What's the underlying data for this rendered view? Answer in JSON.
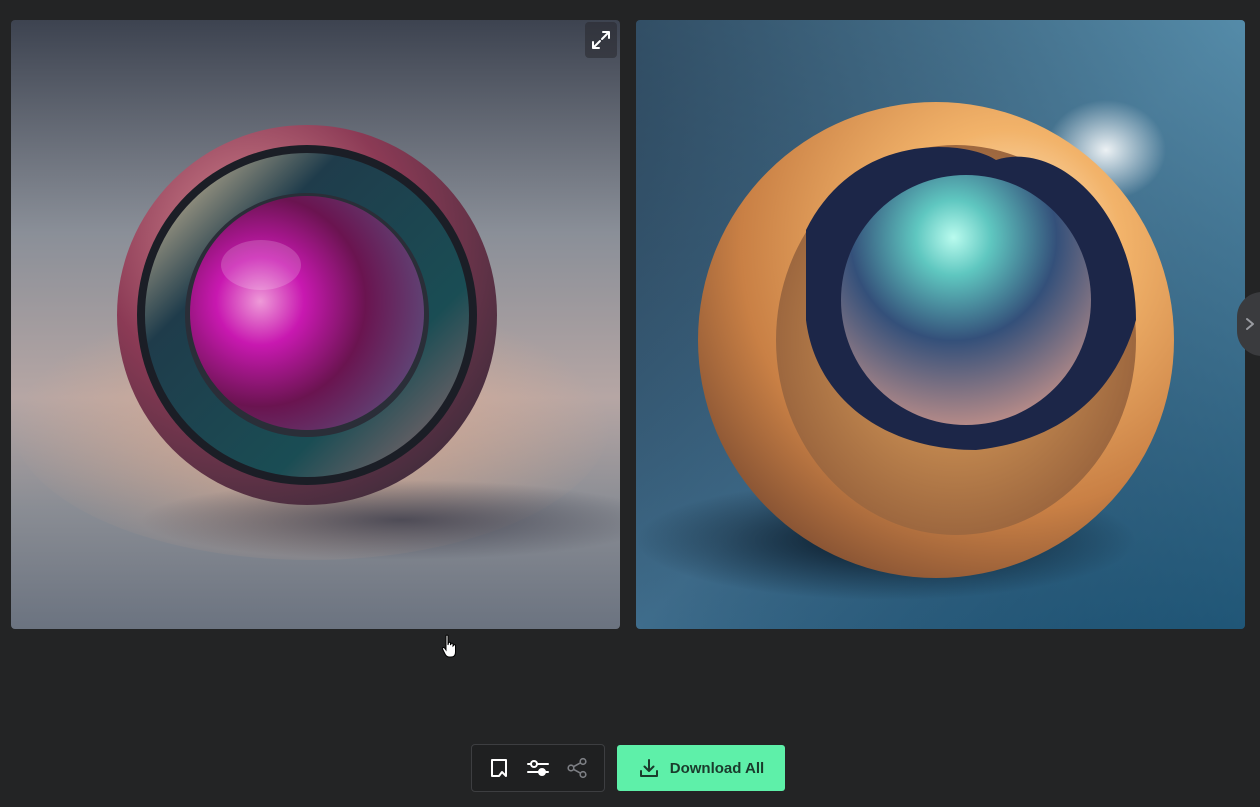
{
  "images": [
    {
      "alt": "",
      "kind": "ring-sphere-magenta"
    },
    {
      "alt": "",
      "kind": "ring-sphere-gold"
    }
  ],
  "toolbar": {
    "icons": [
      "bookmark-icon",
      "sliders-icon",
      "share-icon"
    ]
  },
  "download": {
    "label": "Download All",
    "icon": "download-icon"
  },
  "colors": {
    "background": "#232425",
    "accent": "#5ef0a9",
    "accent_text": "#1a3b2c"
  }
}
